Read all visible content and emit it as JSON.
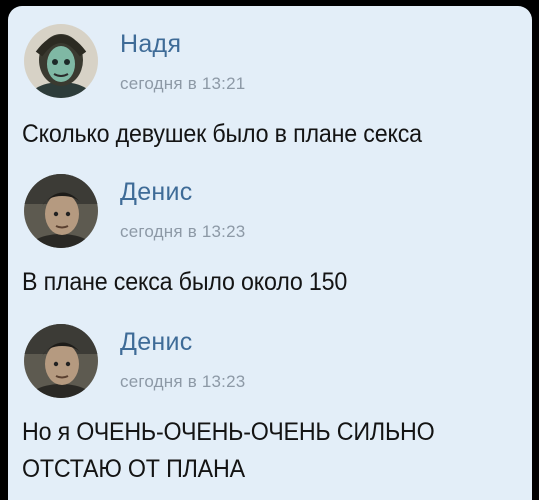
{
  "messages": [
    {
      "author": "Надя",
      "time": "сегодня в 13:21",
      "text": "Сколько девушек было в плане секса",
      "avatar_icon": "user-avatar-nadya"
    },
    {
      "author": "Денис",
      "time": "сегодня в 13:23",
      "text": "В плане секса было около 150",
      "avatar_icon": "user-avatar-denis"
    },
    {
      "author": "Денис",
      "time": "сегодня в 13:23",
      "text": "Но я ОЧЕНЬ-ОЧЕНЬ-ОЧЕНЬ СИЛЬНО ОТСТАЮ ОТ ПЛАНА",
      "avatar_icon": "user-avatar-denis"
    }
  ],
  "colors": {
    "background": "#e3eef8",
    "author_name": "#3e6b97",
    "timestamp": "#8d99a6",
    "message_text": "#141414"
  }
}
